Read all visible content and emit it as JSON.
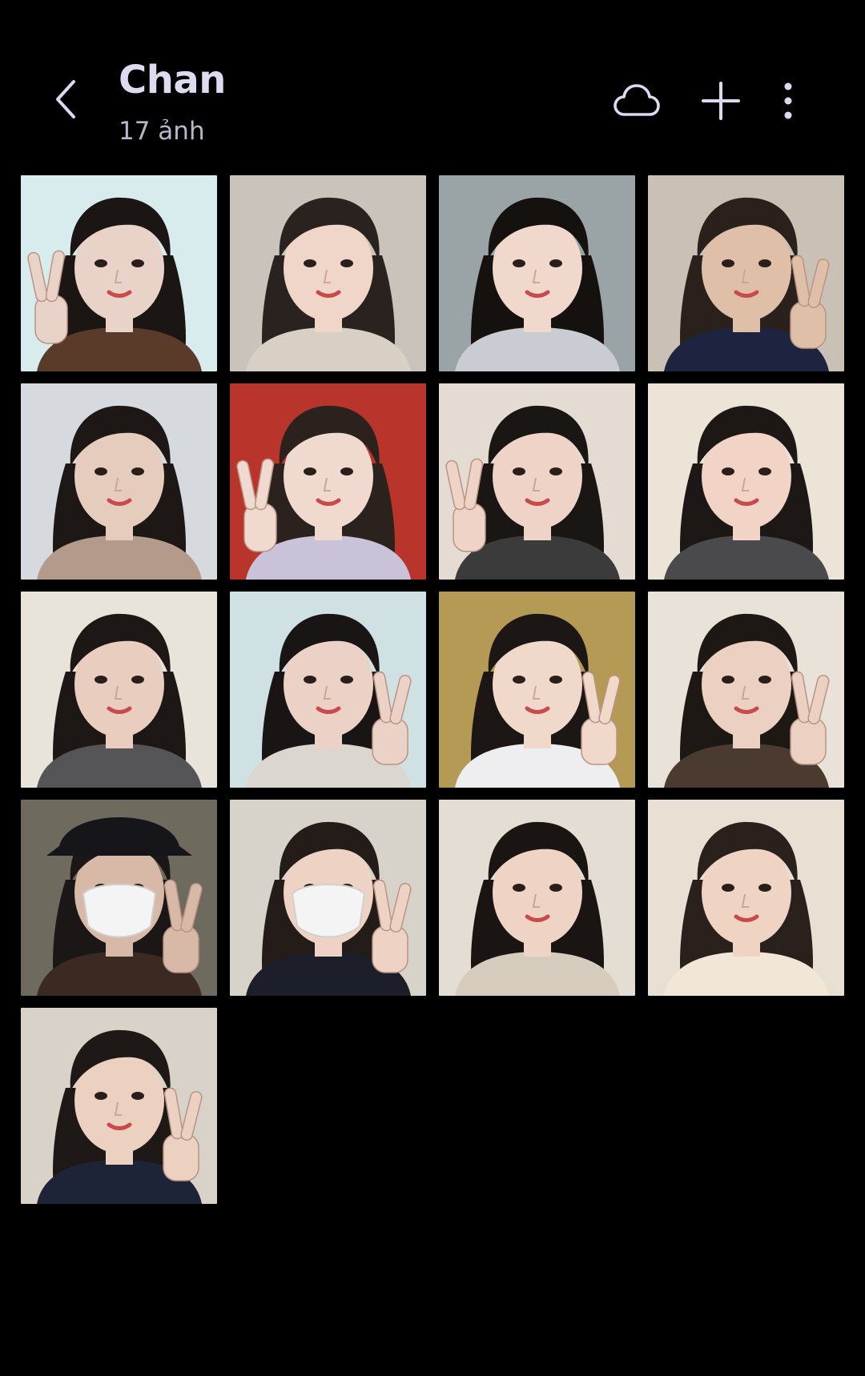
{
  "header": {
    "title": "Chan",
    "subtitle": "17 ảnh"
  },
  "icons": {
    "back": "chevron-left-icon",
    "cloud": "cloud-icon",
    "add": "plus-icon",
    "more": "more-vertical-icon"
  },
  "colors": {
    "background": "#000000",
    "text_primary": "#dddbf0",
    "text_secondary": "#b9b7c9",
    "icon": "#dcdaf0"
  },
  "photos": [
    {
      "bg": "#d8ecee",
      "hair": "#1b1614",
      "skin": "#e9d3c8",
      "shirt": "#5a3a28",
      "peace": "left",
      "mask": false,
      "hat": false
    },
    {
      "bg": "#c9c3bb",
      "hair": "#2a221e",
      "skin": "#efd6c8",
      "shirt": "#d8d0c4",
      "peace": "none",
      "mask": false,
      "hat": false
    },
    {
      "bg": "#9aa3a6",
      "hair": "#15110f",
      "skin": "#f0d8cc",
      "shirt": "#c9ccd2",
      "peace": "none",
      "mask": false,
      "hat": false
    },
    {
      "bg": "#c9c1b6",
      "hair": "#2a211c",
      "skin": "#e0bfa8",
      "shirt": "#1e2340",
      "peace": "right",
      "mask": false,
      "hat": false
    },
    {
      "bg": "#d6dade",
      "hair": "#1d1815",
      "skin": "#e6ccbd",
      "shirt": "#b39a8a",
      "peace": "none",
      "mask": false,
      "hat": false
    },
    {
      "bg": "#b9352b",
      "hair": "#2b221e",
      "skin": "#f0d9cf",
      "shirt": "#c9c2d8",
      "peace": "left",
      "mask": false,
      "hat": false
    },
    {
      "bg": "#e4dcd2",
      "hair": "#1a1614",
      "skin": "#efd3c6",
      "shirt": "#3c3b3c",
      "peace": "left",
      "mask": false,
      "hat": false
    },
    {
      "bg": "#ece4d6",
      "hair": "#1d1816",
      "skin": "#f1d4c6",
      "shirt": "#4a4a4c",
      "peace": "none",
      "mask": false,
      "hat": false
    },
    {
      "bg": "#e9e4da",
      "hair": "#1d1715",
      "skin": "#e9cdbf",
      "shirt": "#555557",
      "peace": "none",
      "mask": false,
      "hat": false
    },
    {
      "bg": "#cfe1e3",
      "hair": "#191514",
      "skin": "#ecd2c6",
      "shirt": "#dcd6d0",
      "peace": "right",
      "mask": false,
      "hat": false
    },
    {
      "bg": "#b59a55",
      "hair": "#1c1715",
      "skin": "#f0d8cb",
      "shirt": "#eeeef0",
      "peace": "right",
      "mask": false,
      "hat": false
    },
    {
      "bg": "#e9e2d8",
      "hair": "#1e1815",
      "skin": "#ecd0c2",
      "shirt": "#4a3a30",
      "peace": "right",
      "mask": false,
      "hat": false
    },
    {
      "bg": "#6f6a5e",
      "hair": "#1a1716",
      "skin": "#d8b8a6",
      "shirt": "#3a2a22",
      "peace": "right",
      "mask": true,
      "hat": true
    },
    {
      "bg": "#d7d3cb",
      "hair": "#231c19",
      "skin": "#eed3c4",
      "shirt": "#1c1e2a",
      "peace": "right",
      "mask": true,
      "hat": false
    },
    {
      "bg": "#e3ddd3",
      "hair": "#1a1513",
      "skin": "#efd4c6",
      "shirt": "#d6ccbd",
      "peace": "none",
      "mask": false,
      "hat": false
    },
    {
      "bg": "#e8e0d2",
      "hair": "#2a201c",
      "skin": "#efd4c4",
      "shirt": "#f2e6d6",
      "peace": "none",
      "mask": false,
      "hat": false
    },
    {
      "bg": "#d8d2c8",
      "hair": "#1e1816",
      "skin": "#ecd0c0",
      "shirt": "#1e2438",
      "peace": "right",
      "mask": false,
      "hat": false
    }
  ]
}
